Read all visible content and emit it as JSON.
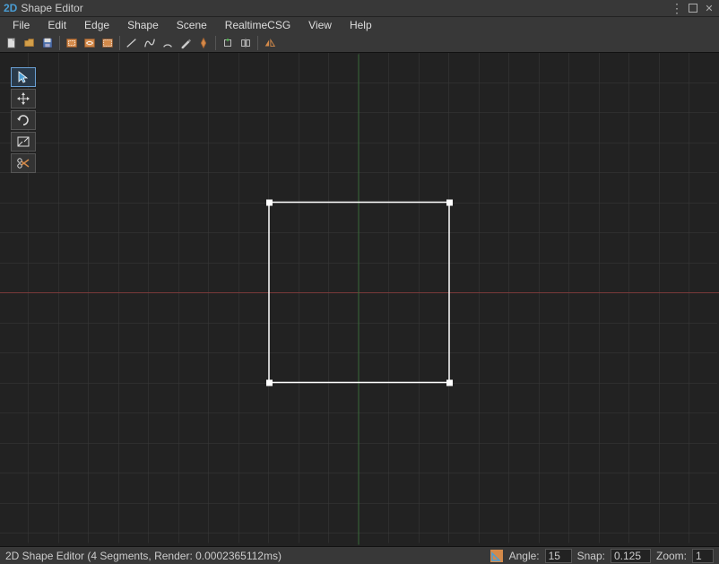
{
  "title": {
    "prefix": "2D",
    "rest": "Shape Editor"
  },
  "menubar": {
    "items": [
      "File",
      "Edit",
      "Edge",
      "Shape",
      "Scene",
      "RealtimeCSG",
      "View",
      "Help"
    ]
  },
  "toolbar": {
    "icons": [
      "new-icon",
      "open-icon",
      "save-icon",
      "select-rect-icon",
      "select-free-icon",
      "select-all-icon",
      "line-icon",
      "bezier-icon",
      "arc-icon",
      "pencil-icon",
      "pen-icon",
      "add-icon",
      "flip-icon",
      "mirror-icon"
    ]
  },
  "sideTools": {
    "items": [
      {
        "name": "pointer-tool",
        "selected": true
      },
      {
        "name": "move-tool",
        "selected": false
      },
      {
        "name": "rotate-tool",
        "selected": false
      },
      {
        "name": "scale-tool",
        "selected": false
      },
      {
        "name": "cut-tool",
        "selected": false
      }
    ]
  },
  "statusbar": {
    "text": "2D Shape Editor (4 Segments, Render: 0.0002365112ms)",
    "angleLabel": "Angle:",
    "angleValue": "15",
    "snapLabel": "Snap:",
    "snapValue": "0.125",
    "zoomLabel": "Zoom:",
    "zoomValue": "1"
  },
  "colors": {
    "accent": "#4a9dd4",
    "gridMinor": "#3a3a3a",
    "gridMajor": "#454545",
    "axisX": "#7a3a3a",
    "axisY": "#3a6a3a",
    "shape": "#ffffff"
  }
}
